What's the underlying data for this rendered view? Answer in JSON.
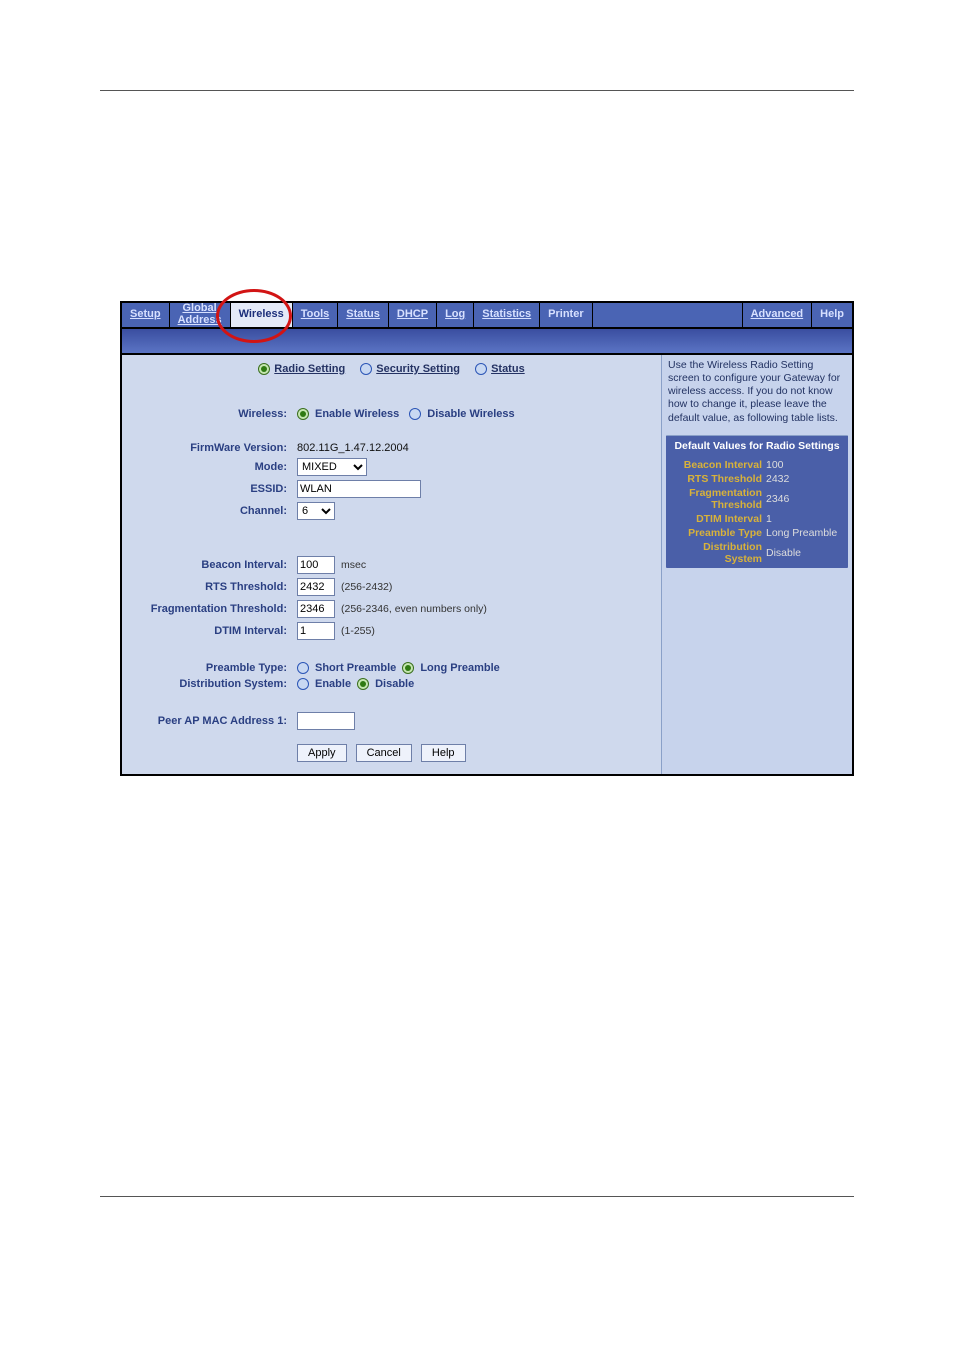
{
  "nav": [
    "Setup",
    "Global\nAddress",
    "Wireless",
    "Tools",
    "Status",
    "DHCP",
    "Log",
    "Statistics",
    "Printer"
  ],
  "nav_active_index": 2,
  "nav_right": [
    "Advanced",
    "Help"
  ],
  "subnav": {
    "radio": "Radio Setting",
    "security": "Security Setting",
    "status": "Status",
    "selected": "radio"
  },
  "labels": {
    "wireless": "Wireless:",
    "firmware": "FirmWare Version:",
    "mode": "Mode:",
    "essid": "ESSID:",
    "channel": "Channel:",
    "beacon": "Beacon Interval:",
    "rts": "RTS Threshold:",
    "frag": "Fragmentation Threshold:",
    "dtim": "DTIM Interval:",
    "preamble": "Preamble Type:",
    "dist": "Distribution System:",
    "peer1": "Peer AP MAC Address 1:"
  },
  "radios": {
    "wireless_enable": "Enable Wireless",
    "wireless_disable": "Disable Wireless",
    "wireless_sel": "enable",
    "preamble_short": "Short Preamble",
    "preamble_long": "Long Preamble",
    "preamble_sel": "long",
    "dist_enable": "Enable",
    "dist_disable": "Disable",
    "dist_sel": "disable"
  },
  "values": {
    "firmware": "802.11G_1.47.12.2004",
    "mode": "MIXED",
    "essid": "WLAN",
    "channel": "6",
    "beacon": "100",
    "beacon_hint": "msec",
    "rts": "2432",
    "rts_hint": "(256-2432)",
    "frag": "2346",
    "frag_hint": "(256-2346, even numbers only)",
    "dtim": "1",
    "dtim_hint": "(1-255)",
    "peer1": ""
  },
  "buttons": {
    "apply": "Apply",
    "cancel": "Cancel",
    "help": "Help"
  },
  "side": {
    "help_text": "Use the Wireless Radio Setting screen to configure your Gateway for wireless access. If you do not know how to change it, please leave the default value, as following table lists.",
    "title": "Default Values for Radio Settings",
    "rows": [
      {
        "label": "Beacon Interval",
        "value": "100"
      },
      {
        "label": "RTS Threshold",
        "value": "2432"
      },
      {
        "label": "Fragmentation Threshold",
        "value": "2346"
      },
      {
        "label": "DTIM Interval",
        "value": "1"
      },
      {
        "label": "Preamble Type",
        "value": "Long Preamble"
      },
      {
        "label": "Distribution System",
        "value": "Disable"
      }
    ]
  }
}
